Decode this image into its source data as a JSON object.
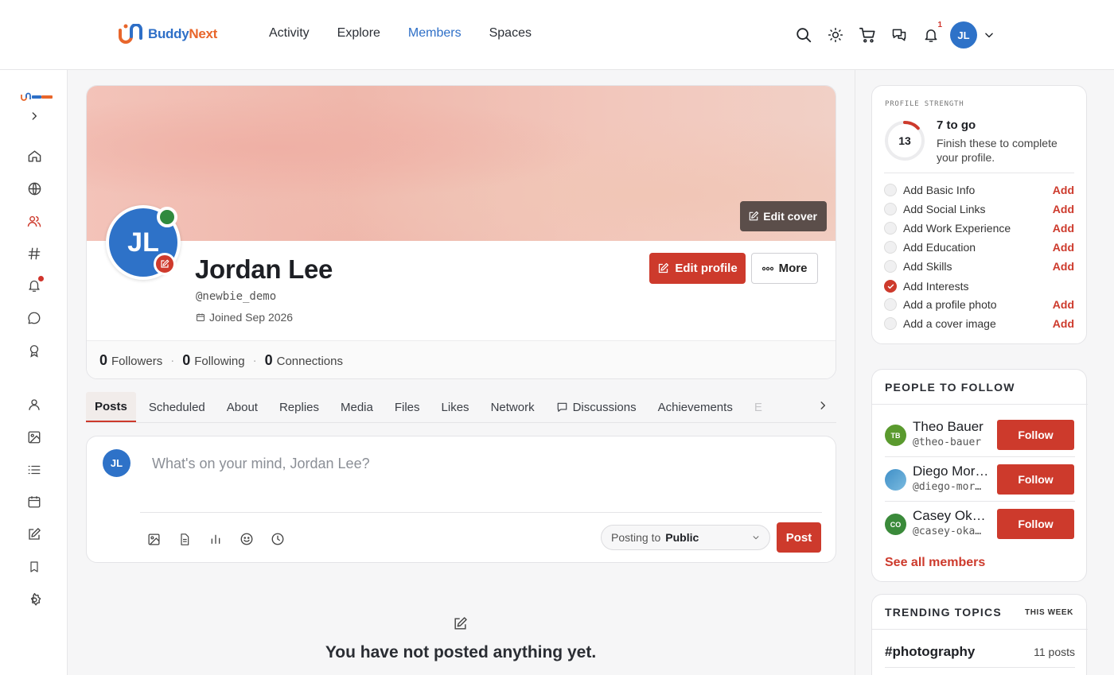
{
  "brand": {
    "name_part1": "Buddy",
    "name_part2": "Next"
  },
  "nav": {
    "items": [
      "Activity",
      "Explore",
      "Members",
      "Spaces"
    ],
    "active": "Members"
  },
  "header": {
    "notification_count": "1",
    "user_initials": "JL"
  },
  "profile": {
    "name": "Jordan Lee",
    "handle": "@newbie_demo",
    "joined": "Joined Sep 2026",
    "initials": "JL",
    "edit_cover_label": "Edit cover",
    "edit_profile_label": "Edit profile",
    "more_label": "More",
    "stats": {
      "followers_count": "0",
      "followers_label": "Followers",
      "following_count": "0",
      "following_label": "Following",
      "connections_count": "0",
      "connections_label": "Connections"
    }
  },
  "tabs": [
    "Posts",
    "Scheduled",
    "About",
    "Replies",
    "Media",
    "Files",
    "Likes",
    "Network",
    "Discussions",
    "Achievements",
    "E"
  ],
  "composer": {
    "initials": "JL",
    "placeholder": "What's on your mind, Jordan Lee?",
    "posting_to_label": "Posting to",
    "posting_to_value": "Public",
    "post_label": "Post"
  },
  "empty_state": {
    "text": "You have not posted anything yet."
  },
  "profile_strength": {
    "title": "PROFILE STRENGTH",
    "score": "13",
    "score_fraction": 0.13,
    "to_go": "7 to go",
    "subtitle": "Finish these to complete your profile.",
    "tasks": [
      {
        "label": "Add Basic Info",
        "action": "Add",
        "done": false
      },
      {
        "label": "Add Social Links",
        "action": "Add",
        "done": false
      },
      {
        "label": "Add Work Experience",
        "action": "Add",
        "done": false
      },
      {
        "label": "Add Education",
        "action": "Add",
        "done": false
      },
      {
        "label": "Add Skills",
        "action": "Add",
        "done": false
      },
      {
        "label": "Add Interests",
        "action": "",
        "done": true
      },
      {
        "label": "Add a profile photo",
        "action": "Add",
        "done": false
      },
      {
        "label": "Add a cover image",
        "action": "Add",
        "done": false
      }
    ]
  },
  "people_to_follow": {
    "title": "PEOPLE TO FOLLOW",
    "people": [
      {
        "initials": "TB",
        "name": "Theo Bauer",
        "handle": "@theo-bauer",
        "color": "#5a9a2e",
        "follow_label": "Follow"
      },
      {
        "initials": "",
        "name": "Diego Mor…",
        "handle": "@diego-mor…",
        "color": "#4f9fd0",
        "follow_label": "Follow"
      },
      {
        "initials": "CO",
        "name": "Casey Ok…",
        "handle": "@casey-oka…",
        "color": "#3a8a3a",
        "follow_label": "Follow"
      }
    ],
    "see_all": "See all members"
  },
  "trending": {
    "title": "TRENDING TOPICS",
    "period": "THIS WEEK",
    "topics": [
      {
        "tag": "#photography",
        "count": "11 posts"
      }
    ]
  },
  "colors": {
    "accent": "#cd3a2c",
    "link_active": "#2e6fc7",
    "avatar": "#2e72c8",
    "online": "#2f8a3e"
  }
}
